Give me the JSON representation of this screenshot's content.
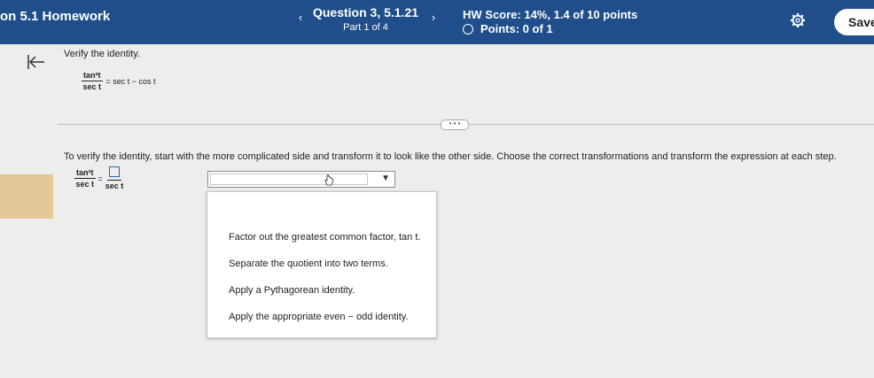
{
  "header": {
    "homework_title": "on 5.1 Homework",
    "question_title": "Question 3, 5.1.21",
    "part": "Part 1 of 4",
    "hw_score": "HW Score: 14%, 1.4 of 10 points",
    "points": "Points: 0 of 1",
    "save_label": "Save",
    "prev_glyph": "‹",
    "next_glyph": "›"
  },
  "question": {
    "instruction": "Verify the identity.",
    "identity": {
      "num": "tan²t",
      "den": "sec t",
      "rhs": "= sec t − cos t"
    },
    "more_glyph": "• • •",
    "task": "To verify the identity, start with the more complicated side and transform it to look like the other side. Choose the correct transformations and transform the expression at each step.",
    "work": {
      "num": "tan²t",
      "den": "sec t",
      "eq": "=",
      "rhs_den": "sec t"
    }
  },
  "dropdown": {
    "options": [
      "Factor out the greatest common factor, tan t.",
      "Separate the quotient into two terms.",
      "Apply a Pythagorean identity.",
      "Apply the appropriate even − odd identity."
    ]
  },
  "colors": {
    "header": "#1f4e8a",
    "accent_strip": "#e3c997",
    "background": "#ededed"
  },
  "icons": [
    "back-arrow-icon",
    "gear-icon",
    "points-circle-icon",
    "hand-cursor-icon",
    "dropdown-caret-icon"
  ]
}
